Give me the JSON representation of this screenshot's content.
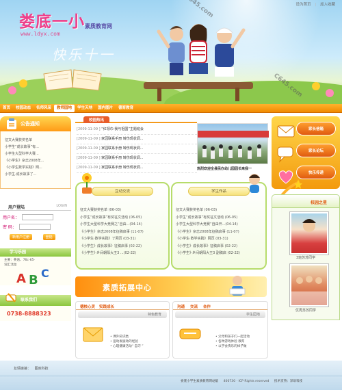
{
  "banner": {
    "logo": "娄底一小",
    "logo_sub": "素质教育网",
    "url": "www.ldyx.com",
    "slogan": "快乐十一",
    "toplinks": [
      "设为首页",
      "加入收藏"
    ],
    "watermarks": [
      "C645.com",
      "C645.com",
      "C645.com"
    ]
  },
  "nav": {
    "items": [
      "首页",
      "校园动态",
      "名师风采",
      "教师园地",
      "学生天地",
      "国内图片",
      "德育教育"
    ],
    "active_index": 3
  },
  "left": {
    "notice_title": "公告通知",
    "notices": [
      "征文大赛获奖名单",
      "小学生“成长故事”有...",
      "小学生大型科学大赛...",
      "《小学生》杂志2008年...",
      "《小学生数学实践》网...",
      "小学生·成长故事了..."
    ],
    "login_title": "用户登陆",
    "login_label": "LOGIN",
    "username_label": "用户名：",
    "password_label": "密  码：",
    "btn_register": "新用户注册",
    "btn_login": "登陆",
    "study_title": "学习乐园",
    "study_text": [
      "主要：英语、76c-65-",
      "词汇活动"
    ],
    "contact_title": "联系我们",
    "phone": "0738-8888323"
  },
  "news": {
    "tab": "校园热讯",
    "items": [
      {
        "date": "[2009-11-09 ]",
        "title": "“红领巾·我与祖国”主题班会"
      },
      {
        "date": "[2009-11-09 ]",
        "title": "家园联系手册 转伤现状调..."
      },
      {
        "date": "[2009-11-09 ]",
        "title": "家园联系手册 转伤现状调..."
      },
      {
        "date": "[2009-11-09 ]",
        "title": "家园联系手册 转伤现状调..."
      },
      {
        "date": "[2009-11-09 ]",
        "title": "家园联系手册 转伤现状调..."
      }
    ],
    "photo_caption": "热烈欢迎全县民办幼儿园园长来我一"
  },
  "panel_exchange": {
    "title": "互动交流",
    "items": [
      "征文大赛获奖名单 (06-03)",
      "小学生“成长故事”有奖征文活动 (06-05)",
      "小学生大型科学大竞赛之“自由...(04-14)",
      "《小学生》杂志2008年征稿启事 (11-07)",
      "《小学生·数学实践》了网页 (03-31)",
      "《小学生》成长故事》征稿启事 (02-22)",
      "《小学生》·乡间朝阳大王3 ...(02-22)"
    ]
  },
  "panel_works": {
    "title": "学生作品",
    "items": [
      "征文大赛获奖名单 (06-03)",
      "小学生“成长故事”有奖征文活动 (06-05)",
      "小学生大型科学大竞赛“自由开...(04-14)",
      "《小学生》杂志2008年征稿启事 (11-07)",
      "《小学生·数学实践》网页 (03-31)",
      "《小学生》成长故事》征稿启事 (02-22)",
      "《小学生》·乡间朝阳大王3 副稿启 (02-22)"
    ]
  },
  "right": {
    "buttons": [
      "家长信箱",
      "家长论坛",
      "快乐传递"
    ],
    "star_title": "校园之星",
    "stars": [
      {
        "name": "3班苏苏同学"
      },
      {
        "name": "优秀苏苏同学"
      }
    ]
  },
  "extension": {
    "banner": "素质拓展中心",
    "left_tabs": [
      "德校心灵",
      "实践成长"
    ],
    "left_bar": "特色教育",
    "left_items": [
      "• 课外知识类",
      "• 运动发展动的经验",
      "• 心理健康活动“ 自习 ”"
    ],
    "right_tabs": [
      "沟通",
      "交流",
      "合作"
    ],
    "right_bar": "学生园地",
    "right_items": [
      "• 父母和孩子们一起活动",
      "• 各种游戏体验 教育",
      "• 以学会快乐的样子做"
    ]
  },
  "footer": {
    "links_label": "友情链接：",
    "links": "图库科技",
    "copyright": "娄底小学生素质教育网站版",
    "contact": "400730 · ICP Rights reserved",
    "support": "技术支持：深圳科技"
  },
  "colors": {
    "accent": "#f39100",
    "brand_pink": "#ee3f8a",
    "green": "#8cc63f"
  }
}
